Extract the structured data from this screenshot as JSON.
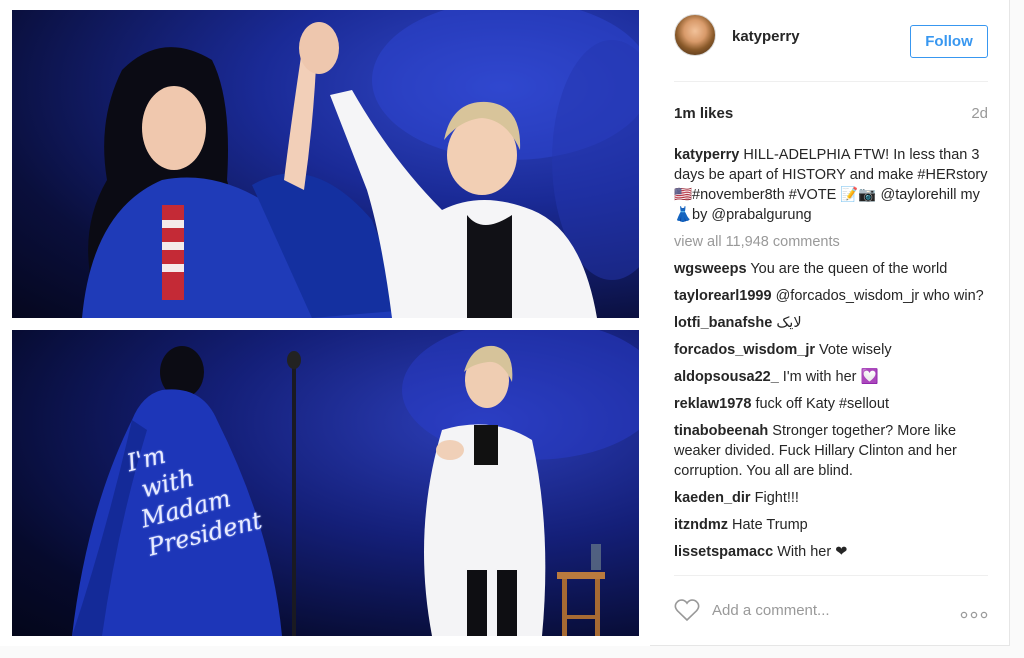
{
  "post": {
    "username": "katyperry",
    "follow_label": "Follow",
    "likes": "1m likes",
    "time_ago": "2d",
    "caption": {
      "user": "katyperry",
      "text": "HILL-ADELPHIA FTW! In less than 3 days be apart of HISTORY and make #HERstory 🇺🇸#november8th #VOTE 📝📷 @taylorehill my 👗by @prabalgurung"
    },
    "view_all_comments": "view all 11,948 comments",
    "comments": [
      {
        "user": "wgsweeps",
        "text": "You are the queen of the world"
      },
      {
        "user": "taylorearl1999",
        "text": "@forcados_wisdom_jr who win?"
      },
      {
        "user": "lotfi_banafshe",
        "text": "لایک"
      },
      {
        "user": "forcados_wisdom_jr",
        "text": "Vote wisely"
      },
      {
        "user": "aldopsousa22_",
        "text": "I'm with her 💟"
      },
      {
        "user": "reklaw1978",
        "text": "fuck off Katy #sellout"
      },
      {
        "user": "tinabobeenah",
        "text": "Stronger together? More like weaker divided. Fuck Hillary Clinton and her corruption. You all are blind."
      },
      {
        "user": "kaeden_dir",
        "text": "Fight!!!"
      },
      {
        "user": "itzndmz",
        "text": "Hate Trump"
      },
      {
        "user": "lissetspamacc",
        "text": "With her ❤"
      }
    ],
    "add_comment_placeholder": "Add a comment...",
    "coat_text": "I'm\n with\nMadam\nPresident"
  },
  "icons": {
    "heart": "heart-icon",
    "more": "more-options-icon",
    "avatar": "avatar"
  },
  "colors": {
    "accent": "#3897f0",
    "text": "#262626",
    "muted": "#999999",
    "stage_blue": "#1a2a96"
  }
}
